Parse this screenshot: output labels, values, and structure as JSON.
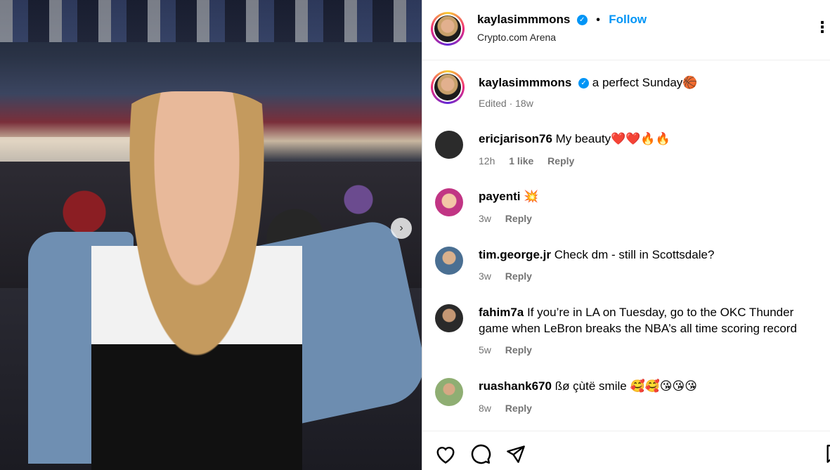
{
  "post": {
    "author": "kaylasimmmons",
    "location": "Crypto.com Arena",
    "follow_label": "Follow",
    "caption_text": "a perfect Sunday",
    "caption_emoji": "🏀",
    "caption_meta": "Edited · 18w"
  },
  "comments": [
    {
      "user": "ericjarison76",
      "text": "My beauty",
      "emoji": "❤️❤️🔥🔥",
      "time": "12h",
      "likes": "1 like",
      "reply": "Reply",
      "avatar_color": "#2b2b2b"
    },
    {
      "user": "payenti",
      "text": "",
      "emoji": "💥",
      "time": "3w",
      "likes": "",
      "reply": "Reply",
      "avatar_color": "#c13584"
    },
    {
      "user": "tim.george.jr",
      "text": "Check dm - still in Scottsdale?",
      "emoji": "",
      "time": "3w",
      "likes": "",
      "reply": "Reply",
      "avatar_color": "#6aa0c9"
    },
    {
      "user": "fahim7a",
      "text": "If you’re in LA on Tuesday, go to the OKC Thunder game when LeBron breaks the NBA’s all time scoring record",
      "emoji": "",
      "time": "5w",
      "likes": "",
      "reply": "Reply",
      "avatar_color": "#3d3d3d"
    },
    {
      "user": "ruashank670",
      "text": "ßø çùtë smile",
      "emoji": "🥰🥰😘😘😘",
      "time": "8w",
      "likes": "",
      "reply": "Reply",
      "avatar_color": "#8fae73"
    }
  ],
  "icons": {
    "verified": "verified-badge-icon",
    "more": "more-options-icon",
    "like": "heart-icon",
    "comment": "comment-bubble-icon",
    "share": "paper-plane-icon",
    "save": "bookmark-icon",
    "carousel_next": "chevron-right-icon"
  },
  "colors": {
    "accent": "#0095f6",
    "muted": "#737373",
    "border": "#dbdbdb"
  }
}
